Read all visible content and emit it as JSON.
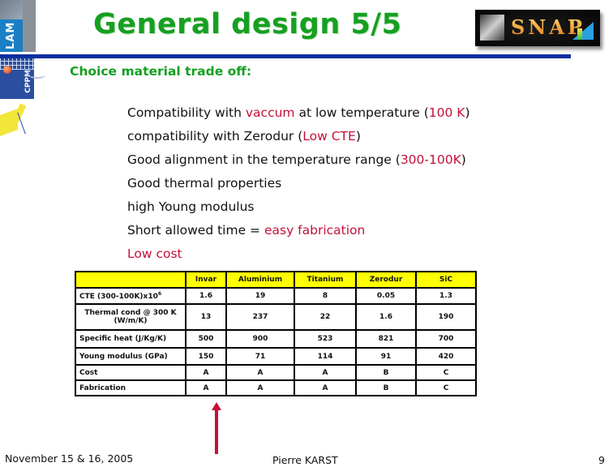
{
  "slide": {
    "title": "General design 5/5",
    "subtitle": "Choice material trade off:",
    "logos": {
      "lam": "LAM",
      "cppm": "CPPM",
      "snap": "SNAP"
    },
    "bullets": [
      {
        "parts": [
          {
            "text": "Compatibility with ",
            "color": "black"
          },
          {
            "text": "vaccum",
            "color": "red"
          },
          {
            "text": " at low temperature (",
            "color": "black"
          },
          {
            "text": "100 K",
            "color": "red"
          },
          {
            "text": ")",
            "color": "black"
          }
        ]
      },
      {
        "parts": [
          {
            "text": "compatibility with Zerodur (",
            "color": "black"
          },
          {
            "text": "Low CTE",
            "color": "red"
          },
          {
            "text": ")",
            "color": "black"
          }
        ]
      },
      {
        "parts": [
          {
            "text": "Good alignment in the temperature range (",
            "color": "black"
          },
          {
            "text": "300-100K",
            "color": "red"
          },
          {
            "text": ")",
            "color": "black"
          }
        ]
      },
      {
        "parts": [
          {
            "text": "Good thermal properties",
            "color": "black"
          }
        ]
      },
      {
        "parts": [
          {
            "text": "high Young modulus",
            "color": "black"
          }
        ]
      },
      {
        "parts": [
          {
            "text": "Short allowed time =  ",
            "color": "black"
          },
          {
            "text": "easy fabrication",
            "color": "red"
          }
        ]
      },
      {
        "parts": [
          {
            "text": "Low cost",
            "color": "red"
          }
        ]
      }
    ],
    "colors": {
      "title_green": "#16a021",
      "accent_red": "#c4103a",
      "rule_blue": "#0a2ea0",
      "table_header_yellow": "#ffff00"
    }
  },
  "table": {
    "headers": [
      "",
      "Invar",
      "Aluminium",
      "Titanium",
      "Zerodur",
      "SiC"
    ],
    "rows": [
      {
        "label": "CTE (300-100K)x10",
        "label_sup": "6",
        "values": [
          "1.6",
          "19",
          "8",
          "0.05",
          "1.3"
        ]
      },
      {
        "label": "Thermal cond @ 300 K",
        "label_line2": "(W/m/K)",
        "values": [
          "13",
          "237",
          "22",
          "1.6",
          "190"
        ]
      },
      {
        "label": "Specific heat (J/Kg/K)",
        "values": [
          "500",
          "900",
          "523",
          "821",
          "700"
        ]
      },
      {
        "label": "Young modulus (GPa)",
        "values": [
          "150",
          "71",
          "114",
          "91",
          "420"
        ]
      },
      {
        "label": "Cost",
        "values": [
          "A",
          "A",
          "A",
          "B",
          "C"
        ]
      },
      {
        "label": "Fabrication",
        "values": [
          "A",
          "A",
          "A",
          "B",
          "C"
        ]
      }
    ],
    "highlighted_column": "Invar"
  },
  "footer": {
    "date": "November 15 & 16, 2005",
    "author": "Pierre KARST",
    "page": "9"
  }
}
